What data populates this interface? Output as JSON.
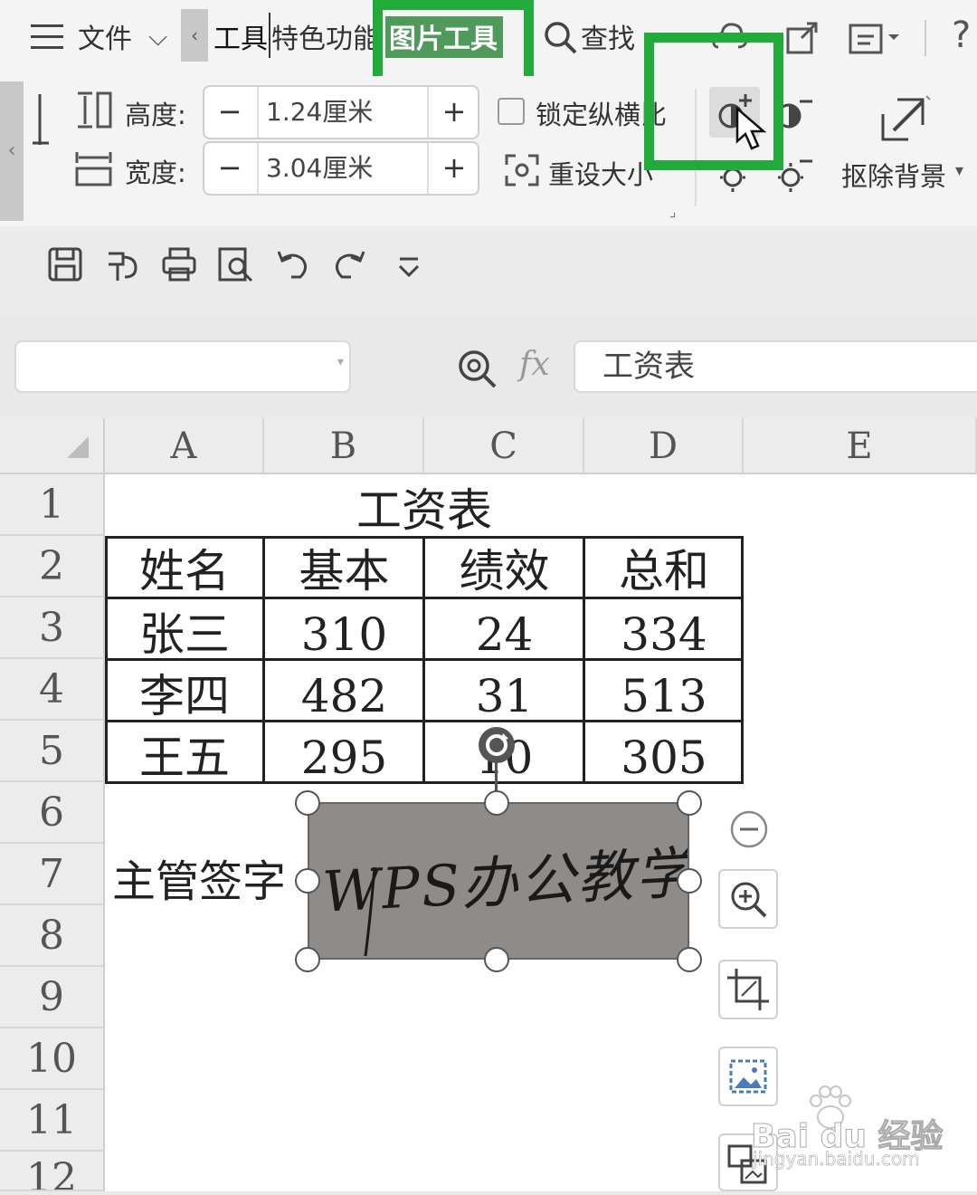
{
  "menubar": {
    "file_label": "文件",
    "tab_tools": "工具",
    "tab_features": "特色功能",
    "tab_picture_tools": "图片工具",
    "search_label": "查找"
  },
  "ribbon": {
    "height_label": "高度:",
    "height_value": "1.24厘米",
    "width_label": "宽度:",
    "width_value": "3.04厘米",
    "lock_ratio_label": "锁定纵横比",
    "reset_size_label": "重设大小",
    "remove_bg_label": "抠除背景",
    "minus": "−",
    "plus": "+"
  },
  "formula_bar": {
    "name_box": "",
    "fx": "fx",
    "content": "工资表"
  },
  "sheet": {
    "columns": [
      "A",
      "B",
      "C",
      "D",
      "E"
    ],
    "rows": [
      "1",
      "2",
      "3",
      "4",
      "5",
      "6",
      "7",
      "8",
      "9",
      "10",
      "11",
      "12"
    ],
    "title": "工资表",
    "headers": [
      "姓名",
      "基本",
      "绩效",
      "总和"
    ],
    "data": [
      [
        "张三",
        "310",
        "24",
        "334"
      ],
      [
        "李四",
        "482",
        "31",
        "513"
      ],
      [
        "王五",
        "295",
        "10",
        "305"
      ]
    ],
    "signature_label": "主管签字",
    "signature_image_text": "WPS办公教学"
  },
  "watermark": {
    "brand": "Bai du 经验",
    "url": "jingyan.baidu.com"
  },
  "colors": {
    "highlight": "#22aa3a",
    "picture_bg": "#8f8b88"
  }
}
